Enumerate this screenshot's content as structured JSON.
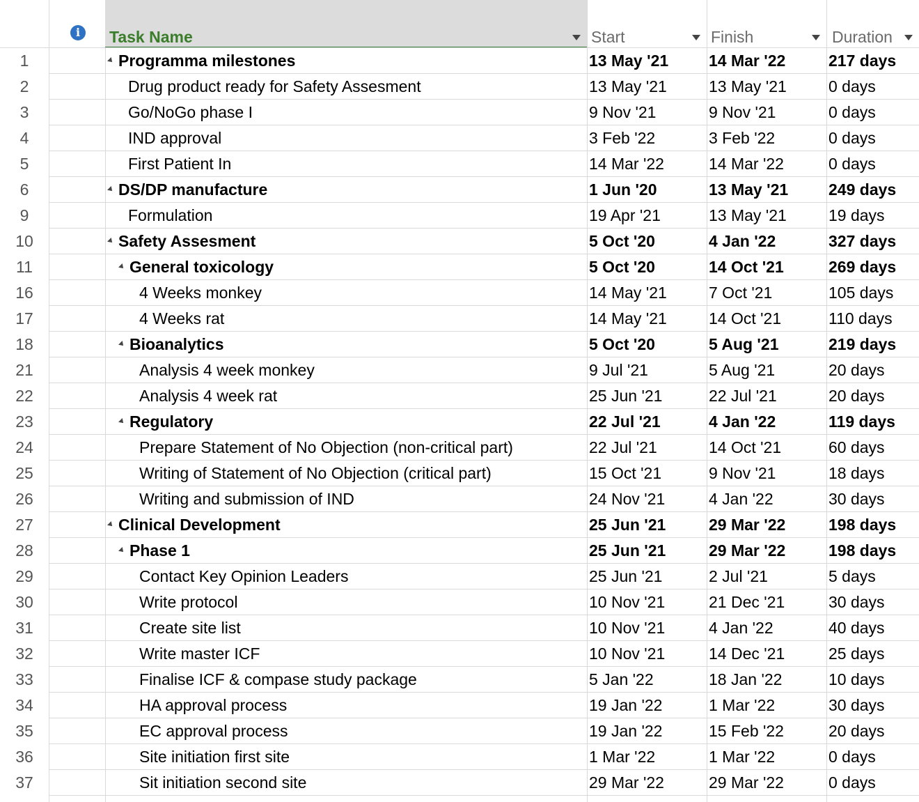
{
  "columns": {
    "info_icon": "info-icon",
    "task_name": "Task Name",
    "start": "Start",
    "finish": "Finish",
    "duration": "Duration"
  },
  "colors": {
    "header_accent": "#3b7d2b",
    "info_icon": "#2f72c4",
    "grid": "#d9d9d9"
  },
  "rows": [
    {
      "id": "1",
      "name": "Programma milestones",
      "start": "13 May '21",
      "finish": "14 Mar '22",
      "duration": "217 days",
      "summary": true,
      "level": 0
    },
    {
      "id": "2",
      "name": "Drug product ready for Safety Assesment",
      "start": "13 May '21",
      "finish": "13 May '21",
      "duration": "0 days",
      "summary": false,
      "level": 1
    },
    {
      "id": "3",
      "name": "Go/NoGo phase I",
      "start": "9 Nov '21",
      "finish": "9 Nov '21",
      "duration": "0 days",
      "summary": false,
      "level": 1
    },
    {
      "id": "4",
      "name": "IND approval",
      "start": "3 Feb '22",
      "finish": "3 Feb '22",
      "duration": "0 days",
      "summary": false,
      "level": 1
    },
    {
      "id": "5",
      "name": "First Patient In",
      "start": "14 Mar '22",
      "finish": "14 Mar '22",
      "duration": "0 days",
      "summary": false,
      "level": 1
    },
    {
      "id": "6",
      "name": "DS/DP manufacture",
      "start": "1 Jun '20",
      "finish": "13 May '21",
      "duration": "249 days",
      "summary": true,
      "level": 0
    },
    {
      "id": "9",
      "name": "Formulation",
      "start": "19 Apr '21",
      "finish": "13 May '21",
      "duration": "19 days",
      "summary": false,
      "level": 1
    },
    {
      "id": "10",
      "name": "Safety Assesment",
      "start": "5 Oct '20",
      "finish": "4 Jan '22",
      "duration": "327 days",
      "summary": true,
      "level": 0
    },
    {
      "id": "11",
      "name": "General toxicology",
      "start": "5 Oct '20",
      "finish": "14 Oct '21",
      "duration": "269 days",
      "summary": true,
      "level": 1
    },
    {
      "id": "16",
      "name": "4 Weeks monkey",
      "start": "14 May '21",
      "finish": "7 Oct '21",
      "duration": "105 days",
      "summary": false,
      "level": 2
    },
    {
      "id": "17",
      "name": "4 Weeks rat",
      "start": "14 May '21",
      "finish": "14 Oct '21",
      "duration": "110 days",
      "summary": false,
      "level": 2
    },
    {
      "id": "18",
      "name": "Bioanalytics",
      "start": "5 Oct '20",
      "finish": "5 Aug '21",
      "duration": "219 days",
      "summary": true,
      "level": 1
    },
    {
      "id": "21",
      "name": "Analysis 4 week monkey",
      "start": "9 Jul '21",
      "finish": "5 Aug '21",
      "duration": "20 days",
      "summary": false,
      "level": 2
    },
    {
      "id": "22",
      "name": "Analysis 4 week rat",
      "start": "25 Jun '21",
      "finish": "22 Jul '21",
      "duration": "20 days",
      "summary": false,
      "level": 2
    },
    {
      "id": "23",
      "name": "Regulatory",
      "start": "22 Jul '21",
      "finish": "4 Jan '22",
      "duration": "119 days",
      "summary": true,
      "level": 1
    },
    {
      "id": "24",
      "name": "Prepare Statement of No Objection (non-critical part)",
      "start": "22 Jul '21",
      "finish": "14 Oct '21",
      "duration": "60 days",
      "summary": false,
      "level": 2
    },
    {
      "id": "25",
      "name": "Writing of Statement of No Objection (critical part)",
      "start": "15 Oct '21",
      "finish": "9 Nov '21",
      "duration": "18 days",
      "summary": false,
      "level": 2
    },
    {
      "id": "26",
      "name": "Writing and submission of IND",
      "start": "24 Nov '21",
      "finish": "4 Jan '22",
      "duration": "30 days",
      "summary": false,
      "level": 2
    },
    {
      "id": "27",
      "name": "Clinical Development",
      "start": "25 Jun '21",
      "finish": "29 Mar '22",
      "duration": "198 days",
      "summary": true,
      "level": 0
    },
    {
      "id": "28",
      "name": "Phase 1",
      "start": "25 Jun '21",
      "finish": "29 Mar '22",
      "duration": "198 days",
      "summary": true,
      "level": 1
    },
    {
      "id": "29",
      "name": "Contact Key Opinion Leaders",
      "start": "25 Jun '21",
      "finish": "2 Jul '21",
      "duration": "5 days",
      "summary": false,
      "level": 2
    },
    {
      "id": "30",
      "name": "Write protocol",
      "start": "10 Nov '21",
      "finish": "21 Dec '21",
      "duration": "30 days",
      "summary": false,
      "level": 2
    },
    {
      "id": "31",
      "name": "Create site list",
      "start": "10 Nov '21",
      "finish": "4 Jan '22",
      "duration": "40 days",
      "summary": false,
      "level": 2
    },
    {
      "id": "32",
      "name": "Write master ICF",
      "start": "10 Nov '21",
      "finish": "14 Dec '21",
      "duration": "25 days",
      "summary": false,
      "level": 2
    },
    {
      "id": "33",
      "name": "Finalise ICF & compase study package",
      "start": "5 Jan '22",
      "finish": "18 Jan '22",
      "duration": "10 days",
      "summary": false,
      "level": 2
    },
    {
      "id": "34",
      "name": "HA approval process",
      "start": "19 Jan '22",
      "finish": "1 Mar '22",
      "duration": "30 days",
      "summary": false,
      "level": 2
    },
    {
      "id": "35",
      "name": "EC approval process",
      "start": "19 Jan '22",
      "finish": "15 Feb '22",
      "duration": "20 days",
      "summary": false,
      "level": 2
    },
    {
      "id": "36",
      "name": "Site initiation first site",
      "start": "1 Mar '22",
      "finish": "1 Mar '22",
      "duration": "0 days",
      "summary": false,
      "level": 2
    },
    {
      "id": "37",
      "name": "Sit initiation second site",
      "start": "29 Mar '22",
      "finish": "29 Mar '22",
      "duration": "0 days",
      "summary": false,
      "level": 2
    }
  ]
}
